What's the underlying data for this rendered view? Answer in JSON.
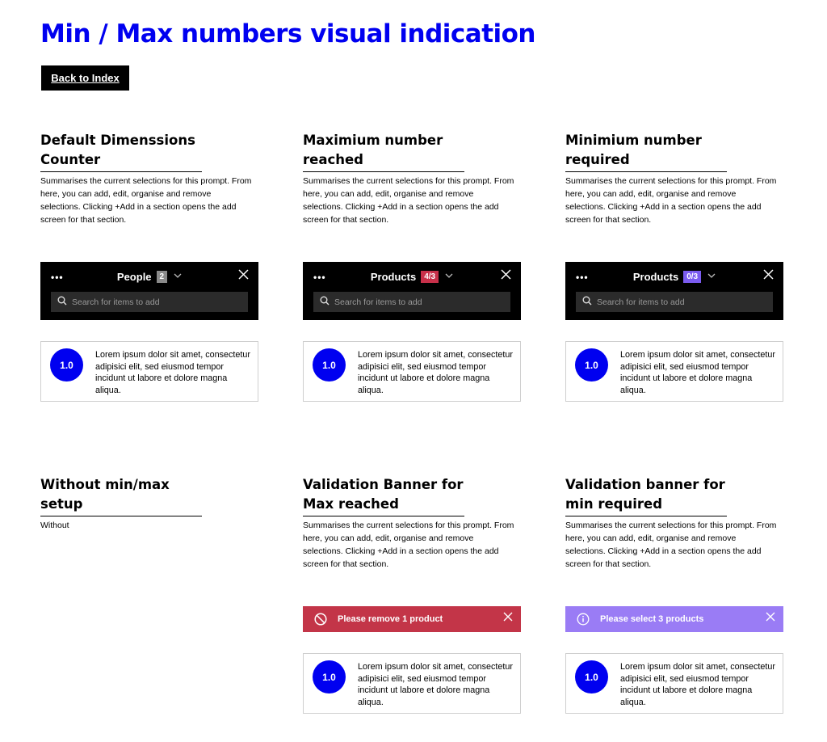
{
  "page": {
    "title": "Min / Max numbers visual indication",
    "back_label": "Back to Index"
  },
  "sections": {
    "default": {
      "title": "Default Dimenssions Counter",
      "desc": "Summarises the current selections for this prompt. From here, you can add, edit, organise and remove selections.  Clicking +Add in a section opens the add screen for that section.",
      "header": {
        "dots": "•••",
        "title": "People",
        "count": "2",
        "search_placeholder": "Search for items to add"
      },
      "card": {
        "number": "1.0",
        "text": "Lorem ipsum dolor sit amet, consectetur adipisici elit, sed eiusmod tempor incidunt ut labore et dolore magna aliqua."
      }
    },
    "max": {
      "title": "Maximium number reached",
      "desc": "Summarises the current selections for this prompt. From here, you can add, edit, organise and remove selections.  Clicking +Add in a section opens the add screen for that section.",
      "header": {
        "dots": "•••",
        "title": "Products",
        "count": "4/3",
        "search_placeholder": "Search for items to add"
      },
      "card": {
        "number": "1.0",
        "text": "Lorem ipsum dolor sit amet, consectetur adipisici elit, sed eiusmod tempor incidunt ut labore et dolore magna aliqua."
      }
    },
    "min": {
      "title": "Minimium number required",
      "desc": "Summarises the current selections for this prompt. From here, you can add, edit, organise and remove selections.  Clicking +Add in a section opens the add screen for that section.",
      "header": {
        "dots": "•••",
        "title": "Products",
        "count": "0/3",
        "search_placeholder": "Search for items to add"
      },
      "card": {
        "number": "1.0",
        "text": "Lorem ipsum dolor sit amet, consectetur adipisici elit, sed eiusmod tempor incidunt ut labore et dolore magna aliqua."
      }
    },
    "without": {
      "title": "Without min/max setup",
      "desc": "Without"
    },
    "banner_max": {
      "title": "Validation Banner for Max reached",
      "desc": "Summarises the current selections for this prompt. From here, you can add, edit, organise and remove selections.  Clicking +Add in a section opens the add screen for that section.",
      "banner_text": "Please remove 1 product",
      "card": {
        "number": "1.0",
        "text": "Lorem ipsum dolor sit amet, consectetur adipisici elit, sed eiusmod tempor incidunt ut labore et dolore magna aliqua."
      }
    },
    "banner_min": {
      "title": "Validation banner for min required",
      "desc": "Summarises the current selections for this prompt. From here, you can add, edit, organise and remove selections.  Clicking +Add in a section opens the add screen for that section.",
      "banner_text": "Please select 3 products",
      "card": {
        "number": "1.0",
        "text": "Lorem ipsum dolor sit amet, consectetur adipisici elit, sed eiusmod tempor incidunt ut labore et dolore magna aliqua."
      }
    }
  },
  "colors": {
    "title_blue": "#0000f0",
    "badge_grey": "#8a8a8a",
    "badge_red": "#c8304a",
    "badge_purple": "#7b5cf0",
    "banner_red": "#c33548",
    "banner_purple": "#9a7cf5",
    "number_circle": "#0000f0"
  },
  "icons": {
    "menu": "more-dots-icon",
    "chevron": "chevron-down-icon",
    "close": "close-icon",
    "search": "search-icon",
    "banner_max": "prohibited-icon",
    "banner_min": "info-icon"
  }
}
